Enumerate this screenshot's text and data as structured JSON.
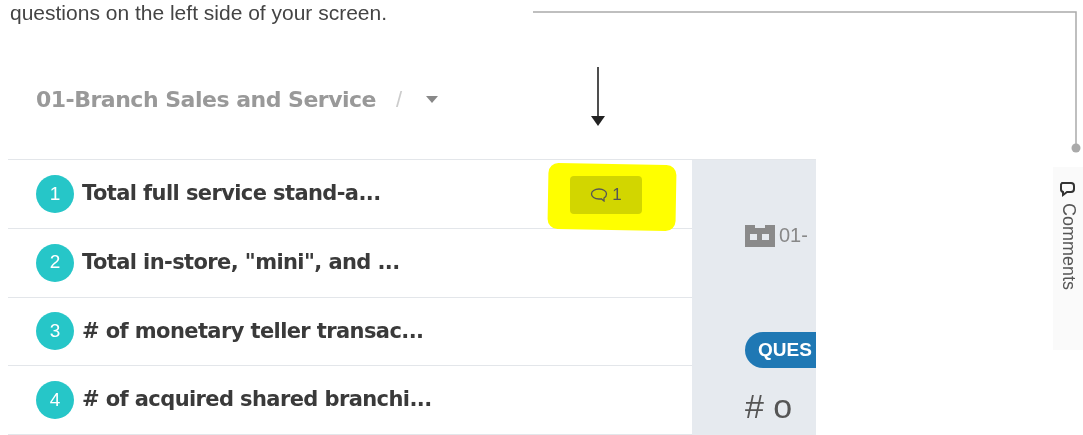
{
  "instruction": {
    "text": "questions on the left side of your screen."
  },
  "breadcrumb": {
    "title": "01-Branch Sales and Service",
    "separator": "/"
  },
  "questions": [
    {
      "number": "1",
      "title": "Total full service stand-a...",
      "comments": "1",
      "highlighted": true
    },
    {
      "number": "2",
      "title": "Total in-store, \"mini\", and ...",
      "highlighted": false
    },
    {
      "number": "3",
      "title": "# of monetary teller transac...",
      "highlighted": false
    },
    {
      "number": "4",
      "title": "# of acquired shared branchi...",
      "highlighted": false
    }
  ],
  "detail": {
    "section": "01-",
    "badge": "QUES",
    "heading": "# o"
  },
  "comments_tab": {
    "label": "Comments"
  }
}
